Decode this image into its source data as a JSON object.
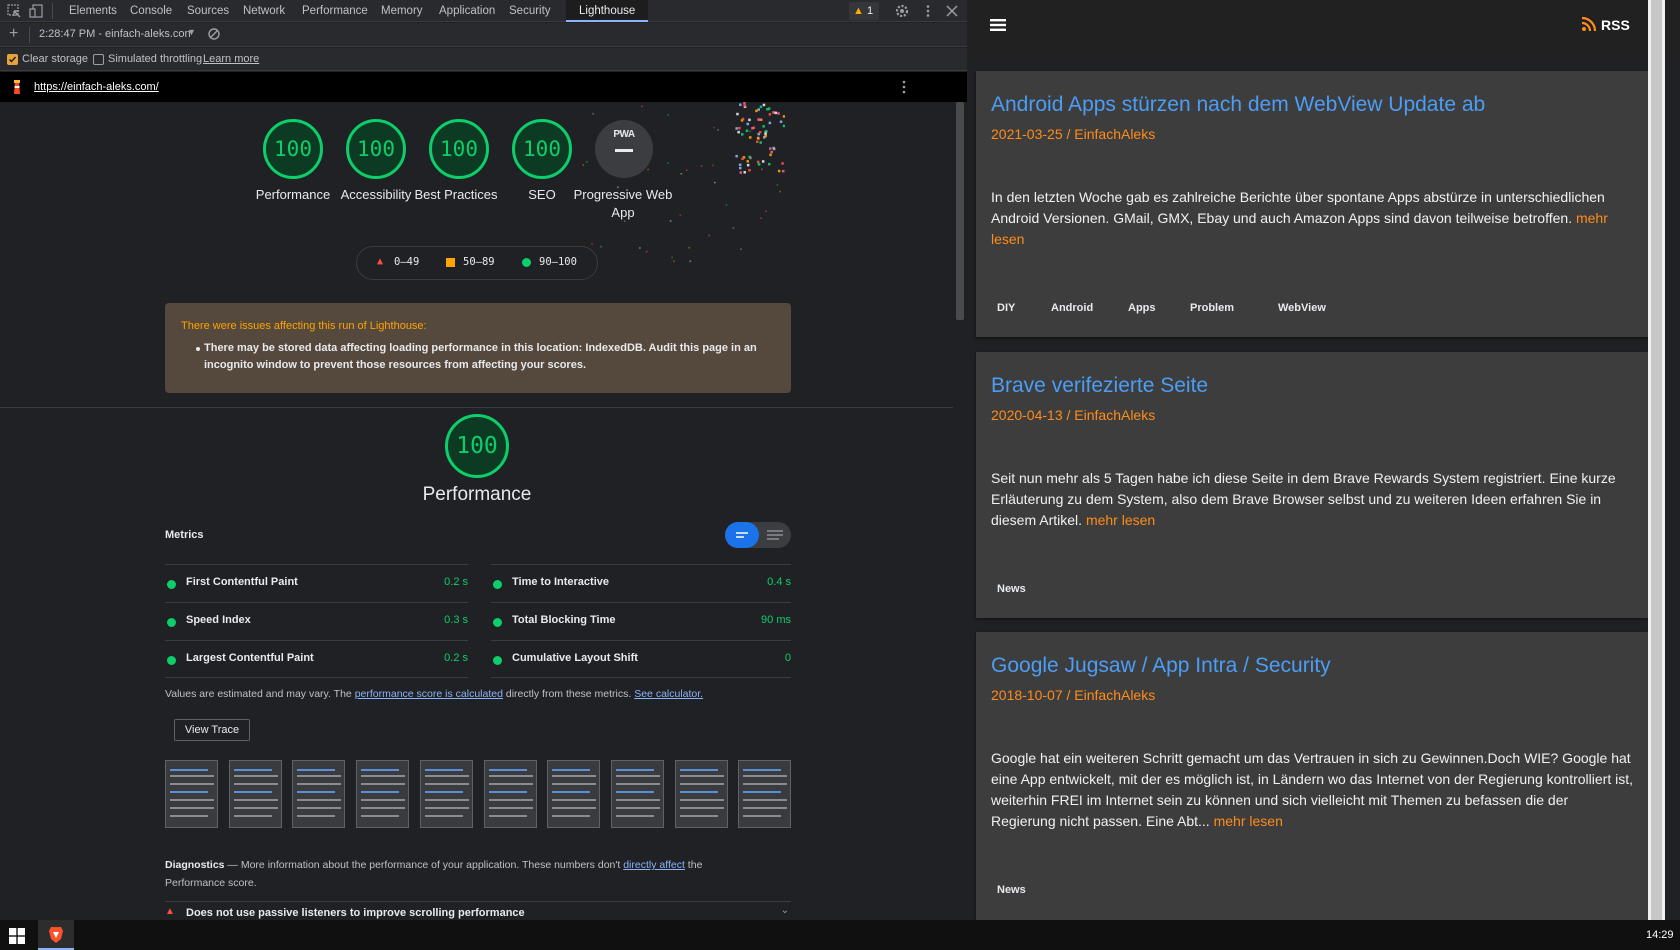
{
  "devtools": {
    "tabs": [
      "Elements",
      "Console",
      "Sources",
      "Network",
      "Performance",
      "Memory",
      "Application",
      "Security",
      "Lighthouse"
    ],
    "active_tab": "Lighthouse",
    "warning_count": "1",
    "report_time": "2:28:47 PM - einfach-aleks.con",
    "clear_storage_label": "Clear storage",
    "simulated_throttling_label": "Simulated throttling",
    "learn_more": "Learn more",
    "url": "https://einfach-aleks.com/"
  },
  "report": {
    "scores": [
      {
        "value": "100",
        "label": "Performance"
      },
      {
        "value": "100",
        "label": "Accessibility"
      },
      {
        "value": "100",
        "label": "Best Practices"
      },
      {
        "value": "100",
        "label": "SEO"
      }
    ],
    "pwa": {
      "badge": "PWA",
      "label": "Progressive Web App"
    },
    "legend": {
      "fail": "0–49",
      "average": "50–89",
      "pass": "90–100"
    },
    "warning": {
      "title": "There were issues affecting this run of Lighthouse:",
      "item": "There may be stored data affecting loading performance in this location: IndexedDB. Audit this page in an incognito window to prevent those resources from affecting your scores."
    },
    "performance": {
      "score": "100",
      "title": "Performance"
    },
    "metrics_heading": "Metrics",
    "metrics": [
      {
        "name": "First Contentful Paint",
        "value": "0.2 s"
      },
      {
        "name": "Time to Interactive",
        "value": "0.4 s"
      },
      {
        "name": "Speed Index",
        "value": "0.3 s"
      },
      {
        "name": "Total Blocking Time",
        "value": "90 ms"
      },
      {
        "name": "Largest Contentful Paint",
        "value": "0.2 s"
      },
      {
        "name": "Cumulative Layout Shift",
        "value": "0"
      }
    ],
    "estimate_note": {
      "before": "Values are estimated and may vary. The ",
      "link1": "performance score is calculated",
      "middle": " directly from these metrics. ",
      "link2": "See calculator."
    },
    "view_trace": "View Trace",
    "diagnostics": {
      "title": "Diagnostics",
      "before": " — More information about the performance of your application. These numbers don't ",
      "link": "directly affect",
      "after": " the Performance score.",
      "first_item": "Does not use passive listeners to improve scrolling performance"
    }
  },
  "blog": {
    "rss_label": "RSS",
    "posts": [
      {
        "title": "Android Apps stürzen nach dem WebView Update ab",
        "meta": "2021-03-25 / EinfachAleks",
        "text": "In den letzten Woche gab es zahlreiche Berichte über spontane Apps abstürze in unterschiedlichen Android Versionen. GMail, GMX, Ebay und auch Amazon Apps sind davon teilweise betroffen.",
        "more": "mehr lesen",
        "tags": [
          "DIY",
          "Android",
          "Apps",
          "Problem",
          "WebView"
        ]
      },
      {
        "title": "Brave verifezierte Seite",
        "meta": "2020-04-13 / EinfachAleks",
        "text": "Seit nun mehr als 5 Tagen habe ich diese Seite in dem Brave Rewards System registriert. Eine kurze Erläuterung zu dem System, also dem Brave Browser selbst und zu weiteren Ideen erfahren Sie in diesem Artikel.",
        "more": "mehr lesen",
        "tags": [
          "News"
        ]
      },
      {
        "title": "Google Jugsaw / App Intra / Security",
        "meta": "2018-10-07 / EinfachAleks",
        "text": "Google hat ein weiteren Schritt gemacht um das Vertrauen in sich zu Gewinnen.Doch WIE? Google hat eine App entwickelt, mit der es möglich ist, in Ländern wo das Internet von der Regierung kontrolliert ist, weiterhin FREI im Internet sein zu können und sich vielleicht mit Themen zu befassen die der Regierung nicht passen. Eine Abt...",
        "more": "mehr lesen",
        "tags": [
          "News"
        ]
      }
    ]
  },
  "taskbar": {
    "clock": "14:29"
  },
  "colors": {
    "pass": "#0cce6b",
    "average": "#ffa400",
    "fail": "#ff4e42",
    "link": "#4c9df5",
    "accent": "#ff8c1a"
  }
}
